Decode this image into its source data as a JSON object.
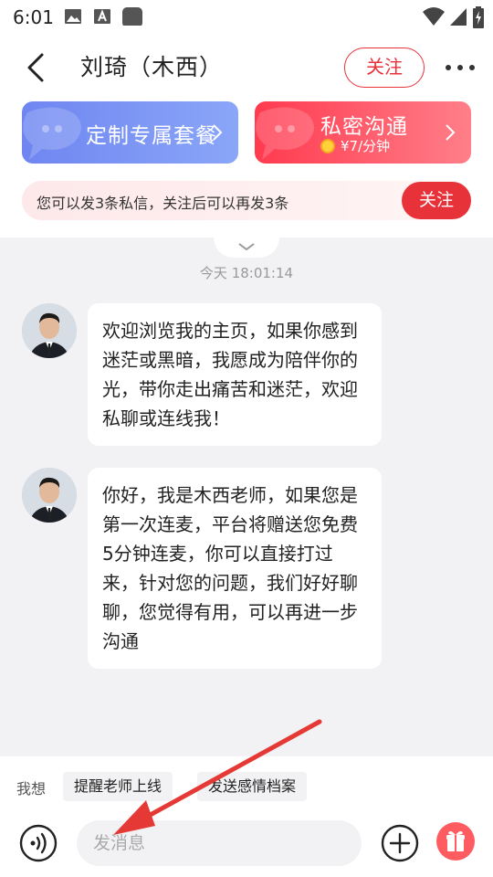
{
  "status_bar": {
    "time": "6:01"
  },
  "header": {
    "title": "刘琦（木西）",
    "follow_label": "关注"
  },
  "banners": {
    "custom": {
      "label": "定制专属套餐"
    },
    "private": {
      "label": "私密沟通",
      "price": "¥7/分钟"
    }
  },
  "notice": {
    "text": "您可以发3条私信，关注后可以再发3条",
    "follow_label": "关注"
  },
  "chat": {
    "timestamp": "今天 18:01:14",
    "messages": [
      {
        "text": "欢迎浏览我的主页，如果你感到迷茫或黑暗，我愿成为陪伴你的光，带你走出痛苦和迷茫，欢迎私聊或连线我！"
      },
      {
        "text": "你好，我是木西老师，如果您是第一次连麦，平台将赠送您免费5分钟连麦，你可以直接打过来，针对您的问题，我们好好聊聊，您觉得有用，可以再进一步沟通"
      }
    ]
  },
  "quick_replies": {
    "label": "我想",
    "chips": [
      "提醒老师上线",
      "发送感情档案"
    ]
  },
  "input": {
    "placeholder": "发消息"
  },
  "colors": {
    "accent": "#e8323a",
    "banner_blue": "#6f86f1",
    "banner_red": "#ff3a4f",
    "annotation_arrow": "#e53935"
  }
}
